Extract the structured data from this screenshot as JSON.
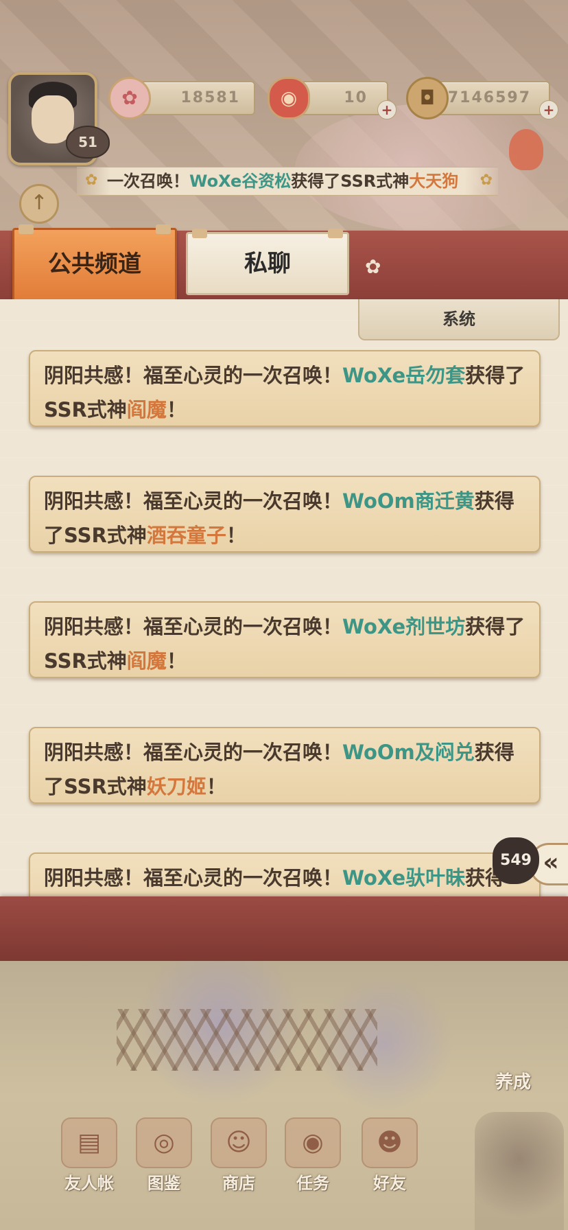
{
  "player": {
    "level": "51"
  },
  "currencies": {
    "sakura_amount": "18581",
    "ticket_amount": "10",
    "coin_amount": "7146597"
  },
  "marquee": {
    "prefix": "一次召唤！",
    "player": "WoXe谷资松",
    "middle": "获得了SSR式神",
    "shikigami": "大天狗"
  },
  "tabs": {
    "public": "公共频道",
    "private": "私聊",
    "system": "系统"
  },
  "messages": [
    {
      "prefix": "阴阳共感！福至心灵的一次召唤！",
      "player": "WoXe岳勿套",
      "middle": "获得了SSR式神",
      "shikigami": "阎魔",
      "suffix": "！"
    },
    {
      "prefix": "阴阳共感！福至心灵的一次召唤！",
      "player": "WoOm商迁黄",
      "middle": "获得了SSR式神",
      "shikigami": "酒吞童子",
      "suffix": "！"
    },
    {
      "prefix": "阴阳共感！福至心灵的一次召唤！",
      "player": "WoXe剂世坊",
      "middle": "获得了SSR式神",
      "shikigami": "阎魔",
      "suffix": "！"
    },
    {
      "prefix": "阴阳共感！福至心灵的一次召唤！",
      "player": "WoOm及闷兑",
      "middle": "获得了SSR式神",
      "shikigami": "妖刀姬",
      "suffix": "！"
    },
    {
      "prefix": "阴阳共感！福至心灵的一次召唤！",
      "player": "WoXe驮叶昧",
      "middle": "获得",
      "shikigami": "",
      "suffix": ""
    }
  ],
  "unread_count": "549",
  "side_label": "养成",
  "bottom_nav": [
    {
      "label": "友人帐",
      "icon": "book-icon"
    },
    {
      "label": "图鉴",
      "icon": "eye-scroll-icon"
    },
    {
      "label": "商店",
      "icon": "lucky-cat-icon"
    },
    {
      "label": "任务",
      "icon": "target-icon"
    },
    {
      "label": "好友",
      "icon": "friends-icon"
    }
  ],
  "colors": {
    "player_name": "#3d9586",
    "shikigami_name": "#d4773c",
    "active_tab": "#e07a36",
    "panel_frame": "#8c3f38"
  }
}
